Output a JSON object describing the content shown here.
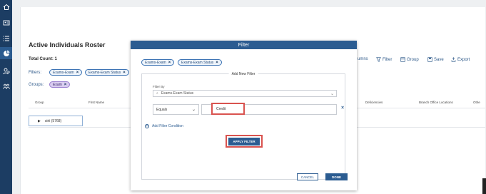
{
  "nav": {
    "icons": [
      "home-icon",
      "id-card-icon",
      "list-icon",
      "chart-pie-icon",
      "user-settings-icon",
      "people-icon"
    ]
  },
  "roster": {
    "title": "Active Individuals Roster",
    "total_count": "Total Count: 1",
    "filters_label": "Filters:",
    "groups_label": "Groups:",
    "filter_chips": [
      "Exams-Exam",
      "Exams-Exam Status"
    ],
    "group_chip": "Exam",
    "toolbar": {
      "columns": "umns",
      "filter": "Filter",
      "group": "Group",
      "save": "Save",
      "export": "Export"
    },
    "columns": {
      "group": "Group",
      "first_name": "First Name",
      "deficiencies": "Deficiencies",
      "branch_office": "Branch Office Locations",
      "other": "Othe"
    },
    "group_row": "sirii (5768)"
  },
  "modal": {
    "title": "Filter",
    "chips": [
      "Exams-Exam",
      "Exams-Exam Status"
    ],
    "new_filter_title": "Add New Filter",
    "filter_by_label": "Filter By",
    "filter_by_value": "Exams-Exam Status",
    "operator": "Equals",
    "value": "Credit",
    "add_condition": "Add Filter Condition",
    "apply": "APPLY FILTER",
    "cancel": "CANCEL",
    "done": "DONE"
  },
  "colors": {
    "nav_bg": "#1c3d63",
    "primary": "#2b5c91",
    "highlight": "#d9534f"
  }
}
